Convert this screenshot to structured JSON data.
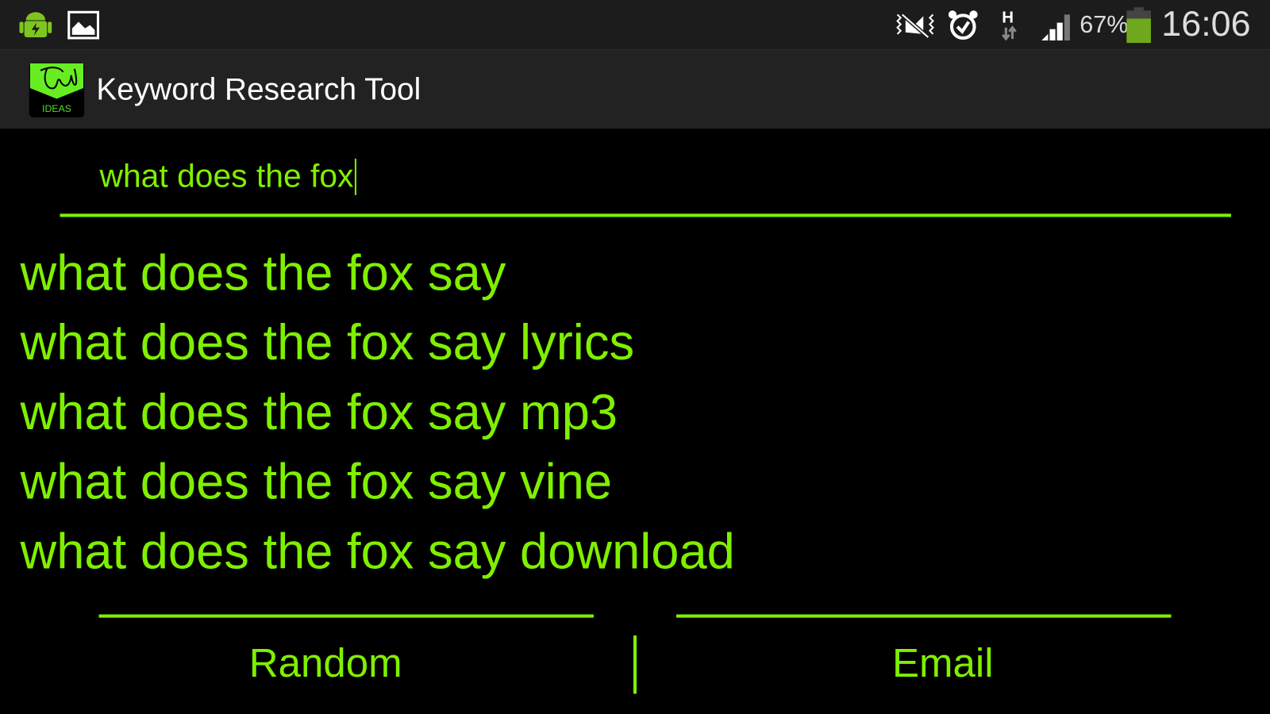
{
  "status_bar": {
    "left_icons": [
      "android-charging-icon",
      "image-notification-icon"
    ],
    "right_icons": [
      "vibrate-mute-icon",
      "alarm-icon",
      "hspa-data-icon",
      "signal-icon"
    ],
    "battery_percent": "67%",
    "battery_level": 0.67,
    "time": "16:06"
  },
  "app_bar": {
    "title": "Keyword Research Tool",
    "logo_text": "IDEAS"
  },
  "search": {
    "value": "what does the fox"
  },
  "suggestions": [
    "what does the fox say",
    "what does the fox say lyrics",
    "what does the fox say mp3",
    "what does the fox say vine",
    "what does the fox say download"
  ],
  "buttons": {
    "random": "Random",
    "email": "Email"
  },
  "colors": {
    "accent": "#7ff000",
    "background": "#000000",
    "battery": "#6fa81c"
  }
}
